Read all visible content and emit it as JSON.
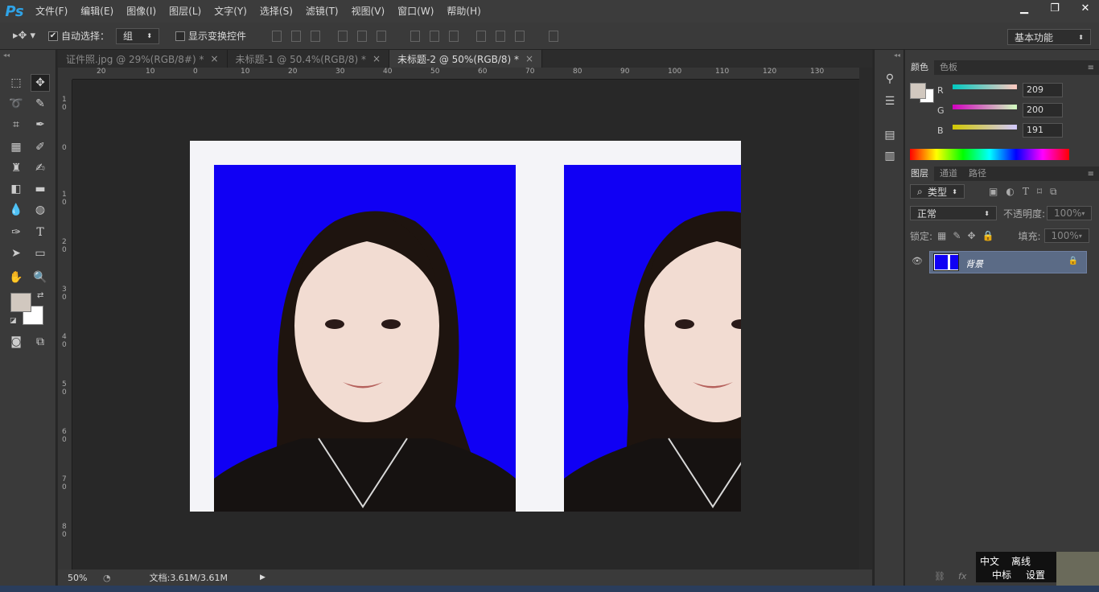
{
  "app": {
    "logo": "Ps"
  },
  "menu": [
    "文件(F)",
    "编辑(E)",
    "图像(I)",
    "图层(L)",
    "文字(Y)",
    "选择(S)",
    "滤镜(T)",
    "视图(V)",
    "窗口(W)",
    "帮助(H)"
  ],
  "window_buttons": {
    "minimize": "▁",
    "restore": "❐",
    "close": "✕"
  },
  "options": {
    "auto_select_label": "自动选择：",
    "auto_select_checked": "✔",
    "auto_select_value": "组",
    "show_transform_label": "显示变换控件",
    "workspace": "基本功能"
  },
  "tabs": [
    {
      "label": "证件照.jpg @ 29%(RGB/8#) *",
      "close": "×"
    },
    {
      "label": "未标题-1 @ 50.4%(RGB/8) *",
      "close": "×"
    },
    {
      "label": "未标题-2 @ 50%(RGB/8) *",
      "close": "×"
    }
  ],
  "ruler": {
    "h": [
      "20",
      "10",
      "0",
      "10",
      "20",
      "30",
      "40",
      "50",
      "60",
      "70",
      "80",
      "90",
      "100",
      "110",
      "120",
      "130"
    ],
    "v": [
      "1\n0",
      "0",
      "1\n0",
      "2\n0",
      "3\n0",
      "4\n0",
      "5\n0",
      "6\n0",
      "7\n0",
      "8\n0"
    ]
  },
  "status": {
    "zoom": "50%",
    "doc": "文档:3.61M/3.61M"
  },
  "color_panel": {
    "tabs": [
      "颜色",
      "色板"
    ],
    "r_label": "R",
    "g_label": "G",
    "b_label": "B",
    "r": "209",
    "g": "200",
    "b": "191",
    "foreground": "#d1c8bf",
    "background": "#ffffff"
  },
  "layers_panel": {
    "tabs": [
      "图层",
      "通道",
      "路径"
    ],
    "filter": "类型",
    "blend_mode": "正常",
    "opacity_label": "不透明度:",
    "opacity": "100%",
    "lock_label": "锁定:",
    "fill_label": "填充:",
    "fill": "100%",
    "layer_name": "背景"
  },
  "ime": {
    "lang": "中文",
    "mode": "离线",
    "scheme": "中标",
    "settings": "设置"
  },
  "colors": {
    "bg_blue": "#1000f4",
    "accent": "#2fa3e7"
  }
}
